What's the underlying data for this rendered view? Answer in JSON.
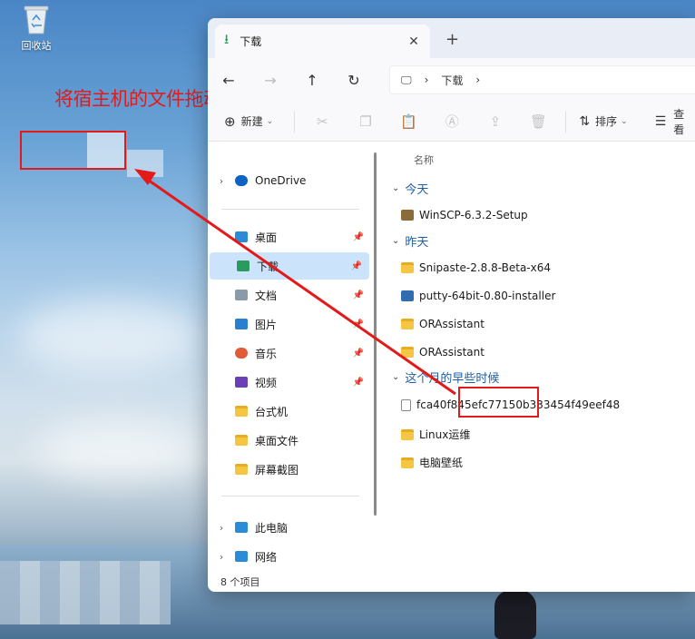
{
  "desktop": {
    "recycle_bin_label": "回收站",
    "annotation": "将宿主机的文件拖动到Windows服务器上"
  },
  "window": {
    "tab_title": "下载",
    "breadcrumb": [
      "下载"
    ],
    "toolbar": {
      "new_label": "新建",
      "sort_label": "排序",
      "view_label": "查看"
    },
    "sidebar": {
      "items": [
        {
          "label": "OneDrive",
          "icon": "cloud-icon",
          "color": "#0b63c5"
        },
        {
          "label": "桌面",
          "icon": "desktop-icon",
          "color": "#2c8bd6",
          "pinned": true
        },
        {
          "label": "下载",
          "icon": "download-icon",
          "color": "#2b9a5e",
          "pinned": true
        },
        {
          "label": "文档",
          "icon": "document-icon",
          "color": "#8a9aa8",
          "pinned": true
        },
        {
          "label": "图片",
          "icon": "pictures-icon",
          "color": "#2a7fd0",
          "pinned": true
        },
        {
          "label": "音乐",
          "icon": "music-icon",
          "color": "#e25b39",
          "pinned": true
        },
        {
          "label": "视频",
          "icon": "video-icon",
          "color": "#6b3fb6",
          "pinned": true
        },
        {
          "label": "台式机",
          "icon": "folder-icon",
          "color": "#f5c544"
        },
        {
          "label": "桌面文件",
          "icon": "folder-icon",
          "color": "#f5c544"
        },
        {
          "label": "屏幕截图",
          "icon": "folder-icon",
          "color": "#f5c544"
        },
        {
          "label": "此电脑",
          "icon": "computer-icon",
          "color": "#2c8bd6"
        },
        {
          "label": "网络",
          "icon": "network-icon",
          "color": "#2c8bd6"
        }
      ]
    },
    "content": {
      "column_name": "名称",
      "groups": [
        {
          "label": "今天",
          "files": [
            {
              "name": "WinSCP-6.3.2-Setup",
              "type": "installer"
            }
          ]
        },
        {
          "label": "昨天",
          "files": [
            {
              "name": "Snipaste-2.8.8-Beta-x64",
              "type": "folder"
            },
            {
              "name": "putty-64bit-0.80-installer",
              "type": "putty"
            },
            {
              "name": "ORAssistant",
              "type": "folder"
            },
            {
              "name": "ORAssistant",
              "type": "folder"
            }
          ]
        },
        {
          "label": "这个月的早些时候",
          "files": [
            {
              "name": "fca40f845efc77150b333454f49eef48",
              "type": "txt"
            },
            {
              "name": "Linux运维",
              "type": "folder"
            },
            {
              "name": "电脑壁纸",
              "type": "folder"
            }
          ]
        }
      ]
    },
    "status": "8 个项目"
  },
  "colors": {
    "annotation_red": "#e21a1a",
    "selection": "#cce4fb",
    "group_blue": "#1f5fa5"
  }
}
